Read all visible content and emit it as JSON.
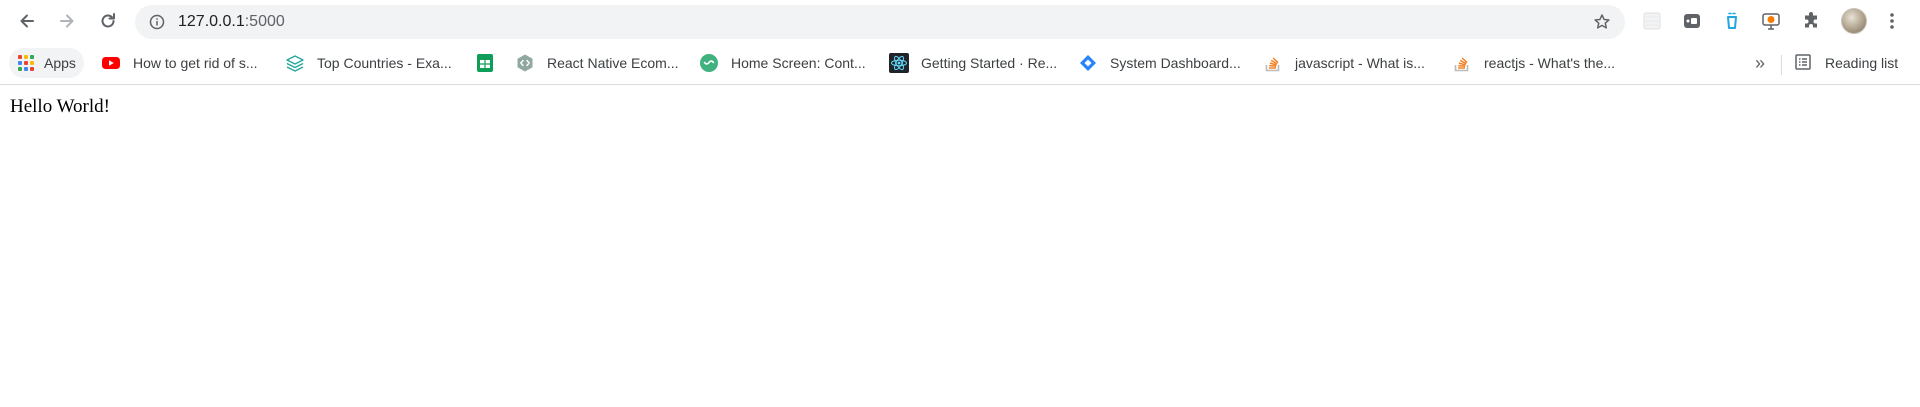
{
  "browser": {
    "url_host": "127.0.0.1",
    "url_port": ":5000",
    "bookmarks_overflow": "»",
    "reading_list_label": "Reading list"
  },
  "bookmarks": [
    {
      "label": "Apps",
      "icon": "apps-grid-icon"
    },
    {
      "label": "How to get rid of s...",
      "icon": "youtube-icon"
    },
    {
      "label": "Top Countries - Exa...",
      "icon": "layers-icon"
    },
    {
      "label": "",
      "icon": "google-sheets-icon"
    },
    {
      "label": "React Native Ecom...",
      "icon": "code-hex-icon"
    },
    {
      "label": "Home Screen: Cont...",
      "icon": "green-circle-icon"
    },
    {
      "label": "Getting Started · Re...",
      "icon": "react-icon"
    },
    {
      "label": "System Dashboard...",
      "icon": "jira-diamond-icon"
    },
    {
      "label": "javascript - What is...",
      "icon": "stackoverflow-icon"
    },
    {
      "label": "reactjs - What's the...",
      "icon": "stackoverflow-icon"
    }
  ],
  "page": {
    "body_text": "Hello World!"
  },
  "colors": {
    "toolbar_bg": "#ffffff",
    "omnibox_bg": "#f1f3f4",
    "text": "#202124",
    "youtube_red": "#ff0000",
    "sheets_green": "#0f9d58",
    "jira_blue": "#2684ff",
    "stackoverflow_orange": "#f48024"
  }
}
